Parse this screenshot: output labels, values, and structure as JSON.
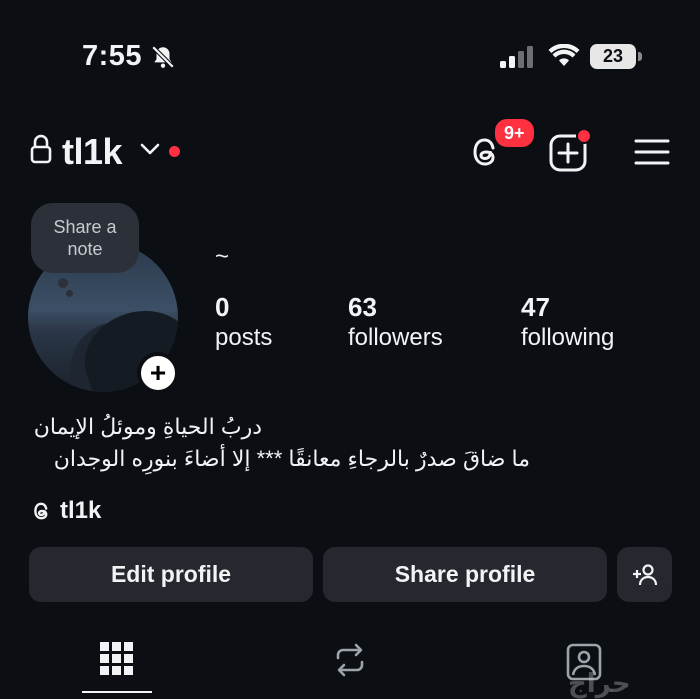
{
  "status_bar": {
    "time": "7:55",
    "battery": "23"
  },
  "header": {
    "username": "tl1k",
    "notification_count": "9+"
  },
  "profile": {
    "note_placeholder": [
      "Share a",
      "note"
    ],
    "name": "~",
    "stats": {
      "posts": {
        "value": "0",
        "label": "posts"
      },
      "followers": {
        "value": "63",
        "label": "followers"
      },
      "following": {
        "value": "47",
        "label": "following"
      }
    },
    "bio": [
      "دربُ الحياةِ وموئلُ الإيمان",
      "ما ضاقَ صدرٌ بالرجاءِ معانقًا *** إلا أضاءَ بنورِه الوجدان"
    ],
    "threads_handle": "tl1k"
  },
  "actions": {
    "edit_label": "Edit profile",
    "share_label": "Share profile"
  },
  "tabs": [
    "grid",
    "reels",
    "tagged"
  ],
  "watermark": "حراج",
  "icons": [
    "bell-off-icon",
    "signal-icon",
    "wifi-icon",
    "lock-icon",
    "chevron-down-icon",
    "threads-icon",
    "new-post-icon",
    "menu-icon",
    "add-user-icon",
    "grid-icon",
    "reels-icon",
    "tagged-icon"
  ],
  "colors": {
    "background": "#0b0f14",
    "button": "#25292f",
    "badge": "#ff3040"
  }
}
